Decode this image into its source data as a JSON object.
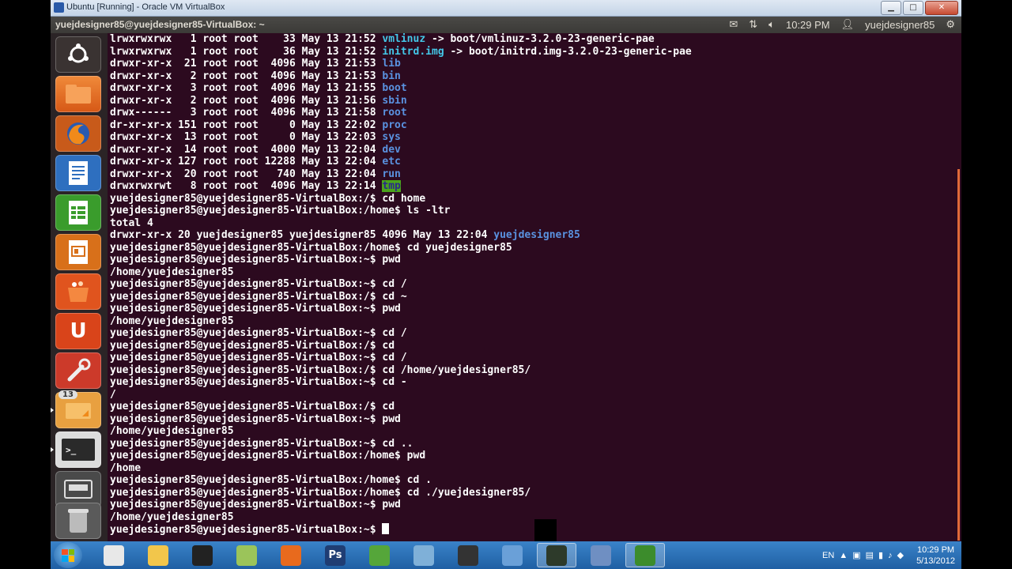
{
  "window": {
    "title": "Ubuntu [Running] - Oracle VM VirtualBox",
    "min": "▁",
    "max": "□",
    "close": "✕"
  },
  "top_panel": {
    "title": "yuejdesigner85@yuejdesigner85-VirtualBox: ~",
    "time": "10:29 PM",
    "user": "yuejdesigner85"
  },
  "launcher": {
    "badge_count": "13",
    "items": [
      {
        "icon": "ubuntu-logo-icon"
      },
      {
        "icon": "home-folder-icon"
      },
      {
        "icon": "firefox-icon"
      },
      {
        "icon": "libreoffice-writer-icon"
      },
      {
        "icon": "libreoffice-calc-icon"
      },
      {
        "icon": "libreoffice-impress-icon"
      },
      {
        "icon": "software-center-icon"
      },
      {
        "icon": "ubuntu-one-icon"
      },
      {
        "icon": "system-settings-icon"
      },
      {
        "icon": "workspaces-icon"
      },
      {
        "icon": "terminal-icon"
      },
      {
        "icon": "show-desktop-icon"
      },
      {
        "icon": "trash-icon"
      }
    ]
  },
  "terminal": {
    "lines": [
      {
        "pre": "lrwxrwxrwx   1 root root    33 May 13 21:52 ",
        "name": "vmlinuz",
        "kind": "cyan",
        "post": " -> boot/vmlinuz-3.2.0-23-generic-pae"
      },
      {
        "pre": "lrwxrwxrwx   1 root root    36 May 13 21:52 ",
        "name": "initrd.img",
        "kind": "cyan",
        "post": " -> boot/initrd.img-3.2.0-23-generic-pae"
      },
      {
        "pre": "drwxr-xr-x  21 root root  4096 May 13 21:53 ",
        "name": "lib",
        "kind": "dir",
        "post": ""
      },
      {
        "pre": "drwxr-xr-x   2 root root  4096 May 13 21:53 ",
        "name": "bin",
        "kind": "dir",
        "post": ""
      },
      {
        "pre": "drwxr-xr-x   3 root root  4096 May 13 21:55 ",
        "name": "boot",
        "kind": "dir",
        "post": ""
      },
      {
        "pre": "drwxr-xr-x   2 root root  4096 May 13 21:56 ",
        "name": "sbin",
        "kind": "dir",
        "post": ""
      },
      {
        "pre": "drwx------   3 root root  4096 May 13 21:58 ",
        "name": "root",
        "kind": "dir",
        "post": ""
      },
      {
        "pre": "dr-xr-xr-x 151 root root     0 May 13 22:02 ",
        "name": "proc",
        "kind": "dir",
        "post": ""
      },
      {
        "pre": "drwxr-xr-x  13 root root     0 May 13 22:03 ",
        "name": "sys",
        "kind": "dir",
        "post": ""
      },
      {
        "pre": "drwxr-xr-x  14 root root  4000 May 13 22:04 ",
        "name": "dev",
        "kind": "dir",
        "post": ""
      },
      {
        "pre": "drwxr-xr-x 127 root root 12288 May 13 22:04 ",
        "name": "etc",
        "kind": "dir",
        "post": ""
      },
      {
        "pre": "drwxr-xr-x  20 root root   740 May 13 22:04 ",
        "name": "run",
        "kind": "dir",
        "post": ""
      },
      {
        "pre": "drwxrwxrwt   8 root root  4096 May 13 22:14 ",
        "name": "tmp",
        "kind": "tmp",
        "post": ""
      },
      {
        "pre": "yuejdesigner85@yuejdesigner85-VirtualBox:/$ cd home",
        "name": "",
        "kind": "",
        "post": ""
      },
      {
        "pre": "yuejdesigner85@yuejdesigner85-VirtualBox:/home$ ls -ltr",
        "name": "",
        "kind": "",
        "post": ""
      },
      {
        "pre": "total 4",
        "name": "",
        "kind": "",
        "post": ""
      },
      {
        "pre": "drwxr-xr-x 20 yuejdesigner85 yuejdesigner85 4096 May 13 22:04 ",
        "name": "yuejdesigner85",
        "kind": "dir",
        "post": ""
      },
      {
        "pre": "yuejdesigner85@yuejdesigner85-VirtualBox:/home$ cd yuejdesigner85",
        "name": "",
        "kind": "",
        "post": ""
      },
      {
        "pre": "yuejdesigner85@yuejdesigner85-VirtualBox:~$ pwd",
        "name": "",
        "kind": "",
        "post": ""
      },
      {
        "pre": "/home/yuejdesigner85",
        "name": "",
        "kind": "",
        "post": ""
      },
      {
        "pre": "yuejdesigner85@yuejdesigner85-VirtualBox:~$ cd /",
        "name": "",
        "kind": "",
        "post": ""
      },
      {
        "pre": "yuejdesigner85@yuejdesigner85-VirtualBox:/$ cd ~",
        "name": "",
        "kind": "",
        "post": ""
      },
      {
        "pre": "yuejdesigner85@yuejdesigner85-VirtualBox:~$ pwd",
        "name": "",
        "kind": "",
        "post": ""
      },
      {
        "pre": "/home/yuejdesigner85",
        "name": "",
        "kind": "",
        "post": ""
      },
      {
        "pre": "yuejdesigner85@yuejdesigner85-VirtualBox:~$ cd /",
        "name": "",
        "kind": "",
        "post": ""
      },
      {
        "pre": "yuejdesigner85@yuejdesigner85-VirtualBox:/$ cd",
        "name": "",
        "kind": "",
        "post": ""
      },
      {
        "pre": "yuejdesigner85@yuejdesigner85-VirtualBox:~$ cd /",
        "name": "",
        "kind": "",
        "post": ""
      },
      {
        "pre": "yuejdesigner85@yuejdesigner85-VirtualBox:/$ cd /home/yuejdesigner85/",
        "name": "",
        "kind": "",
        "post": ""
      },
      {
        "pre": "yuejdesigner85@yuejdesigner85-VirtualBox:~$ cd -",
        "name": "",
        "kind": "",
        "post": ""
      },
      {
        "pre": "/",
        "name": "",
        "kind": "",
        "post": ""
      },
      {
        "pre": "yuejdesigner85@yuejdesigner85-VirtualBox:/$ cd",
        "name": "",
        "kind": "",
        "post": ""
      },
      {
        "pre": "yuejdesigner85@yuejdesigner85-VirtualBox:~$ pwd",
        "name": "",
        "kind": "",
        "post": ""
      },
      {
        "pre": "/home/yuejdesigner85",
        "name": "",
        "kind": "",
        "post": ""
      },
      {
        "pre": "yuejdesigner85@yuejdesigner85-VirtualBox:~$ cd ..",
        "name": "",
        "kind": "",
        "post": ""
      },
      {
        "pre": "yuejdesigner85@yuejdesigner85-VirtualBox:/home$ pwd",
        "name": "",
        "kind": "",
        "post": ""
      },
      {
        "pre": "/home",
        "name": "",
        "kind": "",
        "post": ""
      },
      {
        "pre": "yuejdesigner85@yuejdesigner85-VirtualBox:/home$ cd .",
        "name": "",
        "kind": "",
        "post": ""
      },
      {
        "pre": "yuejdesigner85@yuejdesigner85-VirtualBox:/home$ cd ./yuejdesigner85/",
        "name": "",
        "kind": "",
        "post": ""
      },
      {
        "pre": "yuejdesigner85@yuejdesigner85-VirtualBox:~$ pwd",
        "name": "",
        "kind": "",
        "post": ""
      },
      {
        "pre": "/home/yuejdesigner85",
        "name": "",
        "kind": "",
        "post": ""
      },
      {
        "pre": "yuejdesigner85@yuejdesigner85-VirtualBox:~$ ",
        "name": "",
        "kind": "cursor",
        "post": ""
      }
    ]
  },
  "taskbar": {
    "apps": [
      {
        "icon": "chrome-icon",
        "label": "",
        "color": "#e8e8e8"
      },
      {
        "icon": "explorer-folder-icon",
        "label": "",
        "color": "#f2c64b"
      },
      {
        "icon": "qq-penguin-icon",
        "label": "",
        "color": "#222222"
      },
      {
        "icon": "notepad-icon",
        "label": "",
        "color": "#9bc45a"
      },
      {
        "icon": "firefox-icon",
        "label": "",
        "color": "#e86a1d"
      },
      {
        "icon": "photoshop-icon",
        "label": "Ps",
        "color": "#1f3d73"
      },
      {
        "icon": "utorrent-icon",
        "label": "",
        "color": "#55a63a"
      },
      {
        "icon": "security-icon",
        "label": "",
        "color": "#7fb0d8"
      },
      {
        "icon": "cs4-icon",
        "label": "",
        "color": "#333333"
      },
      {
        "icon": "network-icon",
        "label": "",
        "color": "#6aa0d8"
      },
      {
        "icon": "terminal-app-icon",
        "label": "",
        "color": "#2d3a2a"
      },
      {
        "icon": "virtualbox-icon",
        "label": "",
        "color": "#6f8fc2"
      },
      {
        "icon": "green-app-icon",
        "label": "",
        "color": "#3c8c2c"
      }
    ],
    "lang": "EN",
    "time": "10:29 PM",
    "date": "5/13/2012"
  }
}
